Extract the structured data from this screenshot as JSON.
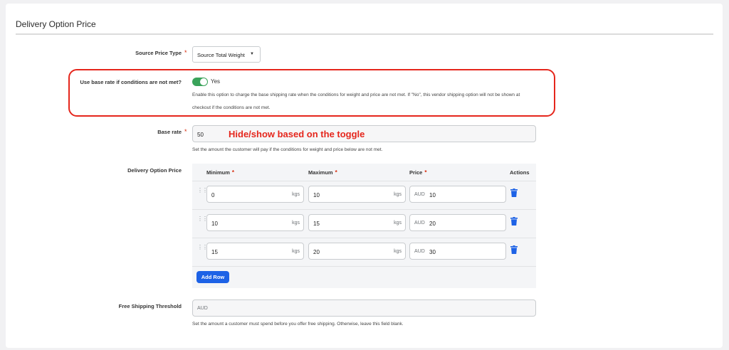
{
  "section": {
    "title": "Delivery Option Price"
  },
  "source_price_type": {
    "label": "Source Price Type",
    "required_mark": "*",
    "value": "Source Total Weight",
    "caret": "▼"
  },
  "use_base_rate": {
    "label": "Use base rate if conditions are not met?",
    "toggle_on": true,
    "toggle_text": "Yes",
    "help_line1": "Enable this option to charge the base shipping rate when the conditions for weight and price are not met. If \"No\", this vendor shipping option will not be shown at",
    "help_line2": "checkout if the conditions are not met."
  },
  "base_rate": {
    "label": "Base rate",
    "required_mark": "*",
    "value": "50",
    "annotation": "Hide/show based on the toggle",
    "help": "Set the amount the customer will pay if the conditions for weight and price below are not met."
  },
  "delivery_option_price": {
    "label": "Delivery Option Price",
    "columns": {
      "minimum": "Minimum",
      "maximum": "Maximum",
      "price": "Price",
      "actions": "Actions",
      "required_mark": "*"
    },
    "rows": [
      {
        "min": "0",
        "min_unit": "kgs",
        "max": "10",
        "max_unit": "kgs",
        "currency": "AUD",
        "price": "10"
      },
      {
        "min": "10",
        "min_unit": "kgs",
        "max": "15",
        "max_unit": "kgs",
        "currency": "AUD",
        "price": "20"
      },
      {
        "min": "15",
        "min_unit": "kgs",
        "max": "20",
        "max_unit": "kgs",
        "currency": "AUD",
        "price": "30"
      }
    ],
    "add_row_label": "Add Row",
    "icons": {
      "drag": "drag-handle-icon",
      "delete": "trash-icon"
    }
  },
  "free_shipping": {
    "label": "Free Shipping Threshold",
    "placeholder": "AUD",
    "help": "Set the amount a customer must spend before you offer free shipping. Otherwise, leave this field blank."
  },
  "colors": {
    "accent": "#1d62e6",
    "toggle_on": "#3aa35a",
    "required": "#d72c0d",
    "annotation": "#e5261c"
  }
}
